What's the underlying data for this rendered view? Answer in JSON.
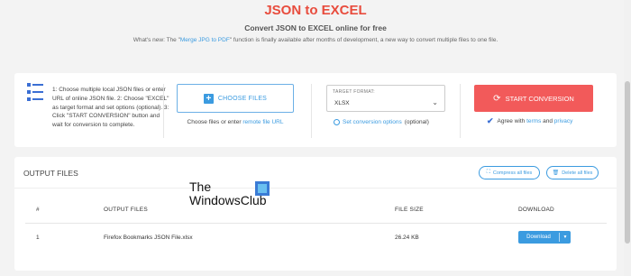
{
  "header": {
    "title": "JSON to EXCEL",
    "subtitle": "Convert JSON to EXCEL online for free",
    "whats_new_prefix": "What's new: The \"",
    "whats_new_link": "Merge JPG to PDF",
    "whats_new_suffix": "\" function is finally available after months of development, a new way to convert multiple files to one file."
  },
  "steps": {
    "text": "1: Choose multiple local JSON files or enter URL of online JSON file. 2: Choose \"EXCEL\" as target format and set options (optional). 3: Click \"START CONVERSION\" button and wait for conversion to complete."
  },
  "choose": {
    "button_label": "CHOOSE FILES",
    "hint_prefix": "Choose files or enter ",
    "hint_link": "remote file URL"
  },
  "format": {
    "label": "TARGET FORMAT:",
    "value": "XLSX",
    "options_link": "Set conversion options",
    "options_suffix": " (optional)"
  },
  "start": {
    "button_label": "START CONVERSION",
    "agree_prefix": "Agree with ",
    "terms_link": "terms",
    "and": " and ",
    "privacy_link": "privacy"
  },
  "output": {
    "title": "OUTPUT FILES",
    "compress_label": "Compress all files",
    "delete_label": "Delete all files",
    "columns": {
      "num": "#",
      "file": "OUTPUT FILES",
      "size": "FILE SIZE",
      "download": "DOWNLOAD"
    },
    "rows": [
      {
        "num": "1",
        "file": "Firefox Bookmarks JSON File.xlsx",
        "size": "26.24 KB",
        "download_label": "Download"
      }
    ]
  },
  "watermark": {
    "line1": "The",
    "line2": "WindowsClub"
  },
  "colors": {
    "accent_red": "#e84c3d",
    "start_button": "#f25a5a",
    "link_blue": "#3b9be0"
  }
}
